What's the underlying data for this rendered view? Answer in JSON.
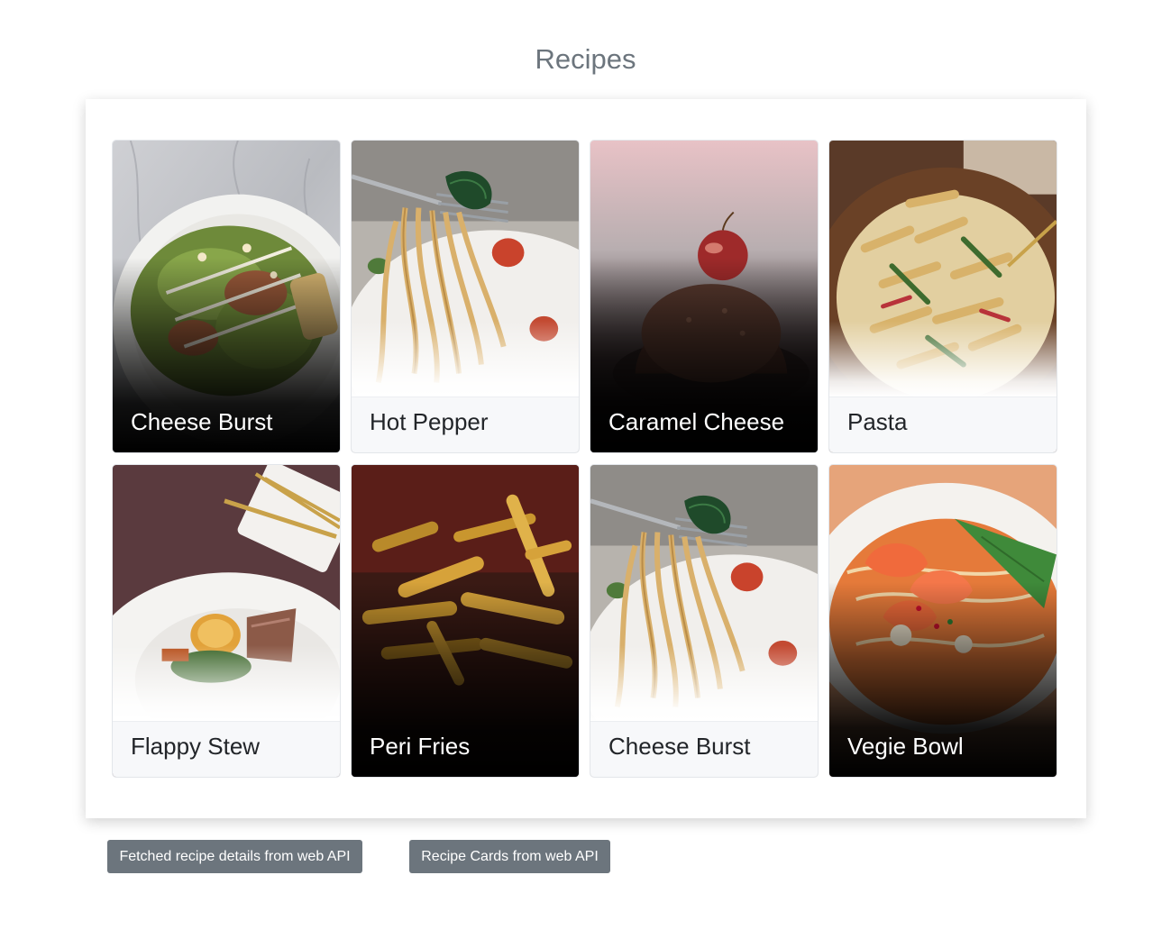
{
  "page": {
    "title": "Recipes"
  },
  "recipes": [
    {
      "title": "Cheese Burst",
      "style": "dark",
      "image": "caesar-salad-plate-on-marble"
    },
    {
      "title": "Hot Pepper",
      "style": "light",
      "image": "spaghetti-on-fork"
    },
    {
      "title": "Caramel Cheese",
      "style": "dark",
      "image": "chocolate-dessert-with-cherry"
    },
    {
      "title": "Pasta",
      "style": "light",
      "image": "penne-pasta-bowl"
    },
    {
      "title": "Flappy Stew",
      "style": "light",
      "image": "plated-meat-with-potato-and-gold-cutlery"
    },
    {
      "title": "Peri Fries",
      "style": "dark",
      "image": "french-fries-closeup"
    },
    {
      "title": "Cheese Burst",
      "style": "light",
      "image": "spaghetti-on-fork"
    },
    {
      "title": "Vegie Bowl",
      "style": "dark",
      "image": "shrimp-noodle-soup-bowl"
    }
  ],
  "buttons": {
    "details_label": "Fetched recipe details from web API",
    "cards_label": "Recipe Cards from web API"
  },
  "colors": {
    "title_text": "#6c757d",
    "button_bg": "#6c757d",
    "button_text": "#ffffff",
    "card_footer_bg": "#f7f8fa"
  }
}
